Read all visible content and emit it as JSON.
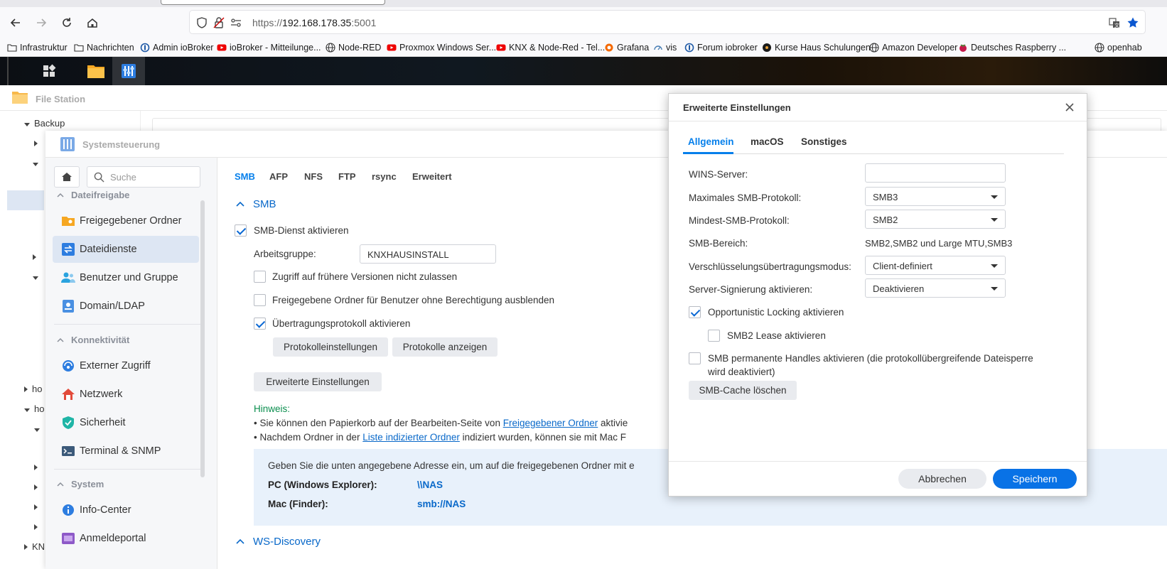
{
  "browser": {
    "url_prefix": "https://",
    "url_host": "192.168.178.35",
    "url_port": ":5001",
    "bookmarks": [
      {
        "label": "Infrastruktur",
        "icon": "folder-icon"
      },
      {
        "label": "Nachrichten",
        "icon": "folder-icon"
      },
      {
        "label": "Admin ioBroker",
        "icon": "iobroker-icon"
      },
      {
        "label": "ioBroker - Mitteilunge...",
        "icon": "youtube-icon"
      },
      {
        "label": "Node-RED",
        "icon": "globe-icon"
      },
      {
        "label": "Proxmox Windows Ser...",
        "icon": "youtube-icon"
      },
      {
        "label": "KNX & Node-Red - Tel...",
        "icon": "youtube-icon"
      },
      {
        "label": "Grafana",
        "icon": "grafana-icon"
      },
      {
        "label": "vis",
        "icon": "vis-icon"
      },
      {
        "label": "Forum iobroker",
        "icon": "iobroker-icon"
      },
      {
        "label": "Kurse Haus Schulungen",
        "icon": "dark-circle-icon"
      },
      {
        "label": "Amazon Developer",
        "icon": "globe-icon"
      },
      {
        "label": "Deutsches Raspberry ...",
        "icon": "raspberry-icon"
      },
      {
        "label": "openhab",
        "icon": "globe-icon"
      }
    ]
  },
  "filestation": {
    "title": "File Station",
    "tree": [
      {
        "label": "Backup"
      },
      {
        "label": "ho"
      },
      {
        "label": "ho"
      },
      {
        "label": "KN"
      }
    ]
  },
  "sysctl": {
    "title": "Systemsteuerung",
    "search_placeholder": "Suche",
    "sections": [
      {
        "title": "Dateifreigabe",
        "items": [
          {
            "label": "Freigegebener Ordner"
          },
          {
            "label": "Dateidienste"
          },
          {
            "label": "Benutzer und Gruppe"
          },
          {
            "label": "Domain/LDAP"
          }
        ]
      },
      {
        "title": "Konnektivität",
        "items": [
          {
            "label": "Externer Zugriff"
          },
          {
            "label": "Netzwerk"
          },
          {
            "label": "Sicherheit"
          },
          {
            "label": "Terminal & SNMP"
          }
        ]
      },
      {
        "title": "System",
        "items": [
          {
            "label": "Info-Center"
          },
          {
            "label": "Anmeldeportal"
          }
        ]
      }
    ],
    "tabs": [
      "SMB",
      "AFP",
      "NFS",
      "FTP",
      "rsync",
      "Erweitert"
    ],
    "smb": {
      "section_title": "SMB",
      "enable_label": "SMB-Dienst aktivieren",
      "workgroup_label": "Arbeitsgruppe:",
      "workgroup_value": "KNXHAUSINSTALL",
      "opt_versions": "Zugriff auf frühere Versionen nicht zulassen",
      "opt_hide": "Freigegebene Ordner für Benutzer ohne Berechtigung ausblenden",
      "opt_log": "Übertragungsprotokoll aktivieren",
      "btn_log_settings": "Protokolleinstellungen",
      "btn_show_logs": "Protokolle anzeigen",
      "btn_advanced": "Erweiterte Einstellungen",
      "hint_title": "Hinweis:",
      "hint1_pre": "• Sie können den Papierkorb auf der Bearbeiten-Seite von ",
      "hint1_link": "Freigegebener Ordner",
      "hint1_post": " aktivie",
      "hint2_pre": "• Nachdem Ordner in der ",
      "hint2_link": "Liste indizierter Ordner",
      "hint2_post": " indiziert wurden, können sie mit Mac F",
      "info_text": "Geben Sie die unten angegebene Adresse ein, um auf die freigegebenen Ordner mit e",
      "pc_label": "PC (Windows Explorer):",
      "pc_value": "\\\\NAS",
      "mac_label": "Mac (Finder):",
      "mac_value": "smb://NAS",
      "ws_title": "WS-Discovery"
    }
  },
  "modal": {
    "title": "Erweiterte Einstellungen",
    "tabs": [
      "Allgemein",
      "macOS",
      "Sonstiges"
    ],
    "rows": {
      "wins_label": "WINS-Server:",
      "wins_value": "",
      "max_label": "Maximales SMB-Protokoll:",
      "max_value": "SMB3",
      "min_label": "Mindest-SMB-Protokoll:",
      "min_value": "SMB2",
      "range_label": "SMB-Bereich:",
      "range_value": "SMB2,SMB2 und Large MTU,SMB3",
      "enc_label": "Verschlüsselungsübertragungsmodus:",
      "enc_value": "Client-definiert",
      "sign_label": "Server-Signierung aktivieren:",
      "sign_value": "Deaktivieren"
    },
    "opportunistic": "Opportunistic Locking aktivieren",
    "lease": "SMB2 Lease aktivieren",
    "durable_line1": "SMB permanente Handles aktivieren (die protokollübergreifende Dateisperre",
    "durable_line2": "wird deaktiviert)",
    "btn_cache": "SMB-Cache löschen",
    "btn_cancel": "Abbrechen",
    "btn_save": "Speichern"
  }
}
